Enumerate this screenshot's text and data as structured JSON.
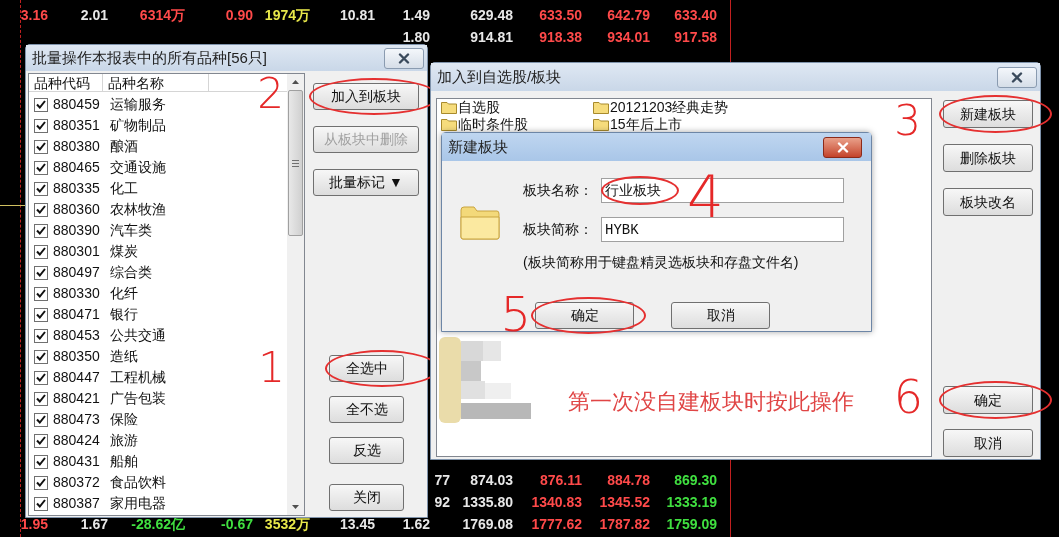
{
  "market_table": {
    "columns": [
      {
        "top": [
          {
            "text": "3.16",
            "color": "#ff4a4a"
          }
        ],
        "bottom": [
          {
            "text": "1.95",
            "color": "#ff4a4a"
          }
        ]
      },
      {
        "top": [
          {
            "text": "2.01",
            "color": "#e8e8e8"
          }
        ],
        "bottom": [
          {
            "text": "1.67",
            "color": "#e8e8e8"
          }
        ]
      },
      {
        "top": [
          {
            "text": "6314万",
            "color": "#ff4a4a"
          }
        ],
        "bottom": [
          {
            "text": "-28.62亿",
            "color": "#40e040"
          }
        ]
      },
      {
        "top": [
          {
            "text": "0.90",
            "color": "#ff4a4a"
          }
        ],
        "bottom": [
          {
            "text": "-0.67",
            "color": "#40e040"
          }
        ]
      },
      {
        "top": [
          {
            "text": "1974万",
            "color": "#e8e84a"
          }
        ],
        "bottom": [
          {
            "text": "3532万",
            "color": "#e8e84a"
          }
        ]
      },
      {
        "top": [
          {
            "text": "10.81",
            "color": "#e8e8e8"
          }
        ],
        "bottom": [
          {
            "text": "13.45",
            "color": "#e8e8e8"
          }
        ]
      },
      {
        "top": [
          {
            "text": "1.49",
            "color": "#e8e8e8"
          },
          {
            "text": "1.80",
            "color": "#e8e8e8"
          }
        ],
        "bottom": [
          {
            "kind": "cut",
            "text": "77",
            "color": "#e8e8e8"
          },
          {
            "kind": "cut",
            "text": "92",
            "color": "#e8e8e8"
          },
          {
            "text": "1.62",
            "color": "#e8e8e8"
          }
        ]
      },
      {
        "top": [
          {
            "text": "629.48",
            "color": "#e8e8e8"
          },
          {
            "text": "914.81",
            "color": "#e8e8e8"
          }
        ],
        "bottom": [
          {
            "text": "874.03",
            "color": "#e8e8e8"
          },
          {
            "text": "1335.80",
            "color": "#e8e8e8"
          },
          {
            "text": "1769.08",
            "color": "#e8e8e8"
          }
        ]
      },
      {
        "top": [
          {
            "text": "633.50",
            "color": "#ff4a4a"
          },
          {
            "text": "918.38",
            "color": "#ff4a4a"
          }
        ],
        "bottom": [
          {
            "text": "876.11",
            "color": "#ff4a4a"
          },
          {
            "text": "1340.83",
            "color": "#ff4a4a"
          },
          {
            "text": "1777.62",
            "color": "#ff4a4a"
          }
        ]
      },
      {
        "top": [
          {
            "text": "642.79",
            "color": "#ff4a4a"
          },
          {
            "text": "934.01",
            "color": "#ff4a4a"
          }
        ],
        "bottom": [
          {
            "text": "884.78",
            "color": "#ff4a4a"
          },
          {
            "text": "1345.52",
            "color": "#ff4a4a"
          },
          {
            "text": "1787.82",
            "color": "#ff4a4a"
          }
        ]
      },
      {
        "top": [
          {
            "text": "633.40",
            "color": "#ff4a4a"
          },
          {
            "text": "917.58",
            "color": "#ff4a4a"
          }
        ],
        "bottom": [
          {
            "text": "869.30",
            "color": "#40e040"
          },
          {
            "text": "1333.19",
            "color": "#40e040"
          },
          {
            "text": "1759.09",
            "color": "#40e040"
          }
        ]
      }
    ]
  },
  "batch_dialog": {
    "title": "批量操作本报表中的所有品种[56只]",
    "columns": [
      "品种代码",
      "品种名称"
    ],
    "items": [
      {
        "code": "880459",
        "name": "运输服务",
        "checked": true
      },
      {
        "code": "880351",
        "name": "矿物制品",
        "checked": true
      },
      {
        "code": "880380",
        "name": "酿酒",
        "checked": true
      },
      {
        "code": "880465",
        "name": "交通设施",
        "checked": true
      },
      {
        "code": "880335",
        "name": "化工",
        "checked": true
      },
      {
        "code": "880360",
        "name": "农林牧渔",
        "checked": true
      },
      {
        "code": "880390",
        "name": "汽车类",
        "checked": true
      },
      {
        "code": "880301",
        "name": "煤炭",
        "checked": true
      },
      {
        "code": "880497",
        "name": "综合类",
        "checked": true
      },
      {
        "code": "880330",
        "name": "化纤",
        "checked": true
      },
      {
        "code": "880471",
        "name": "银行",
        "checked": true
      },
      {
        "code": "880453",
        "name": "公共交通",
        "checked": true
      },
      {
        "code": "880350",
        "name": "造纸",
        "checked": true
      },
      {
        "code": "880447",
        "name": "工程机械",
        "checked": true
      },
      {
        "code": "880421",
        "name": "广告包装",
        "checked": true
      },
      {
        "code": "880473",
        "name": "保险",
        "checked": true
      },
      {
        "code": "880424",
        "name": "旅游",
        "checked": true
      },
      {
        "code": "880431",
        "name": "船舶",
        "checked": true
      },
      {
        "code": "880372",
        "name": "食品饮料",
        "checked": true
      },
      {
        "code": "880387",
        "name": "家用电器",
        "checked": true
      }
    ],
    "top_buttons": [
      {
        "label": "加入到板块",
        "disabled": false,
        "circled": true,
        "step": "2"
      },
      {
        "label": "从板块中删除",
        "disabled": true,
        "circled": false
      },
      {
        "label": "批量标记 ▼",
        "disabled": false,
        "circled": false
      }
    ],
    "bottom_buttons": [
      {
        "label": "全选中",
        "circled": true,
        "step": "1"
      },
      {
        "label": "全不选",
        "circled": false
      },
      {
        "label": "反选",
        "circled": false
      },
      {
        "label": "关闭",
        "circled": false
      }
    ]
  },
  "add_dialog": {
    "title": "加入到自选股/板块",
    "folders": [
      {
        "name": "自选股"
      },
      {
        "name": "20121203经典走势"
      },
      {
        "name": "临时条件股"
      },
      {
        "name": "15年后上市"
      }
    ],
    "note": "第一次没自建板块时按此操作",
    "top_buttons": [
      {
        "label": "新建板块",
        "circled": true,
        "step": "3"
      },
      {
        "label": "删除板块",
        "circled": false
      },
      {
        "label": "板块改名",
        "circled": false
      }
    ],
    "bottom_buttons": [
      {
        "label": "确定",
        "circled": true,
        "step": "6"
      },
      {
        "label": "取消",
        "circled": false
      }
    ]
  },
  "new_block_dialog": {
    "title": "新建板块",
    "fields": [
      {
        "label": "板块名称：",
        "value": "行业板块",
        "circled": true,
        "step": "4"
      },
      {
        "label": "板块简称：",
        "value": "HYBK",
        "circled": false
      }
    ],
    "hint": "(板块简称用于键盘精灵选板块和存盘文件名)",
    "buttons": [
      {
        "label": "确定",
        "circled": true,
        "step": "5"
      },
      {
        "label": "取消",
        "circled": false
      }
    ]
  }
}
